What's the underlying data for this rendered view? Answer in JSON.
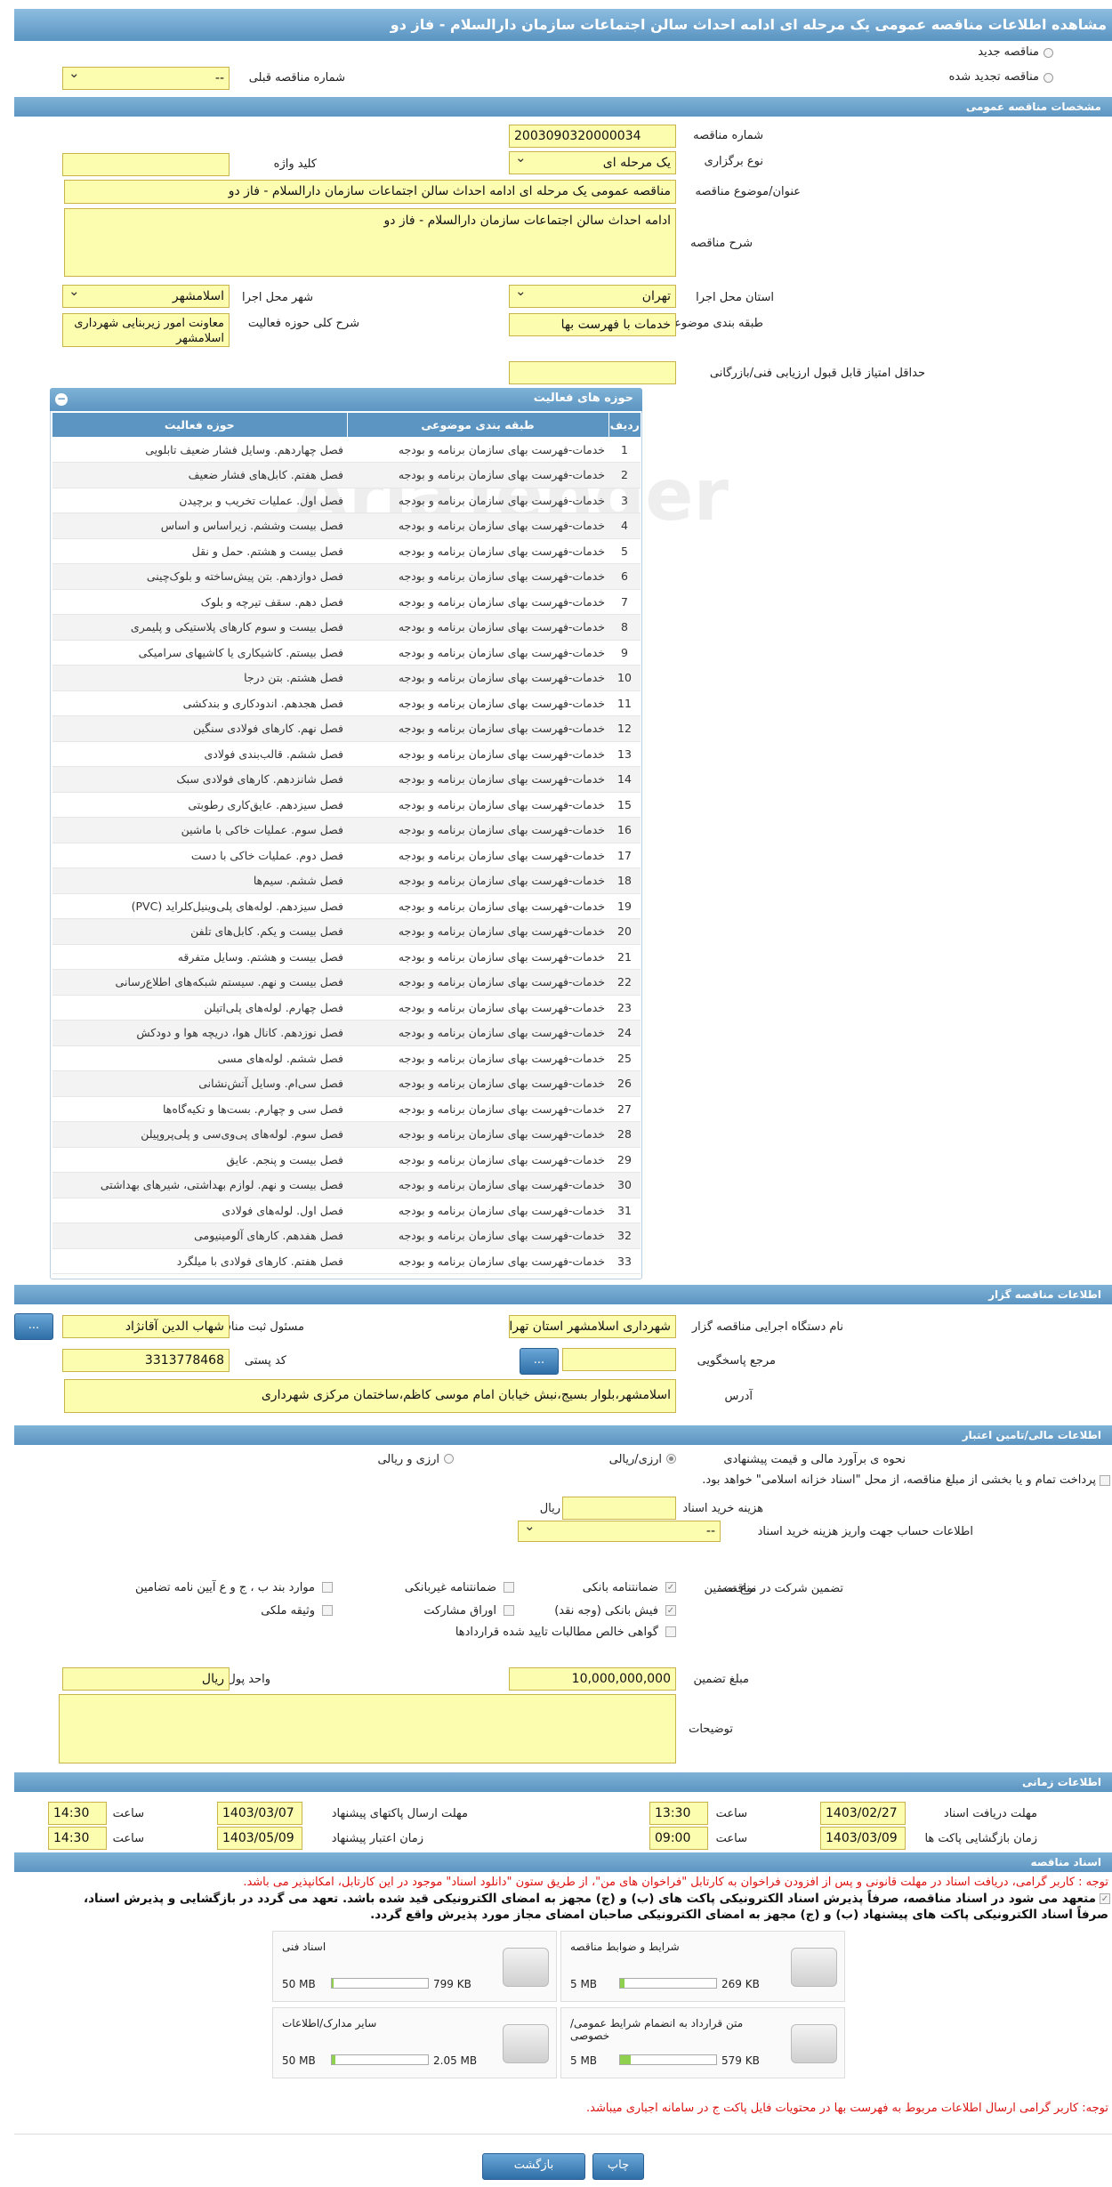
{
  "title": "مشاهده اطلاعات مناقصه عمومی یک مرحله ای ادامه احداث سالن اجتماعات سازمان دارالسلام - فاز دو",
  "top": {
    "new_tender": "مناقصه جدید",
    "renewed_tender": "مناقصه تجدید شده",
    "prev_number_label": "شماره مناقصه قبلی",
    "prev_number_value": "--"
  },
  "general": {
    "header": "مشخصات مناقصه عمومی",
    "number_label": "شماره مناقصه",
    "number_value": "2003090320000034",
    "type_label": "نوع برگزاری",
    "type_value": "یک مرحله ای",
    "keyword_label": "کلید واژه",
    "keyword_value": "",
    "subject_label": "عنوان/موضوع مناقصه",
    "subject_value": "مناقصه عمومی یک مرحله ای ادامه احداث سالن اجتماعات سازمان دارالسلام - فاز دو",
    "desc_label": "شرح مناقصه",
    "desc_value": "ادامه احداث سالن اجتماعات سازمان دارالسلام - فاز دو",
    "province_label": "استان محل اجرا",
    "province_value": "تهران",
    "city_label": "شهر محل اجرا",
    "city_value": "اسلامشهر",
    "category_label": "طبقه بندی موضوعی",
    "category_value": "خدمات با فهرست بها",
    "activity_desc_label": "شرح کلی حوزه فعالیت",
    "activity_desc_value": "معاونت امور زیربنایی شهرداری اسلامشهر",
    "min_score_label": "حداقل امتیاز قابل قبول ارزیابی فنی/بازرگانی",
    "min_score_value": ""
  },
  "activities": {
    "header": "حوزه های فعالیت",
    "col_row": "ردیف",
    "col_category": "طبقه بندی موضوعی",
    "col_field": "حوزه فعالیت",
    "rows": [
      {
        "n": "1",
        "c": "خدمات-فهرست بهای سازمان برنامه و بودجه",
        "f": "فصل چهاردهم. وسایل فشار ضعیف تابلویی"
      },
      {
        "n": "2",
        "c": "خدمات-فهرست بهای سازمان برنامه و بودجه",
        "f": "فصل هفتم. کابل‌های فشار ضعیف"
      },
      {
        "n": "3",
        "c": "خدمات-فهرست بهای سازمان برنامه و بودجه",
        "f": "فصل اول. عملیات تخریب و برچیدن"
      },
      {
        "n": "4",
        "c": "خدمات-فهرست بهای سازمان برنامه و بودجه",
        "f": "فصل بیست وششم. زیراساس و اساس"
      },
      {
        "n": "5",
        "c": "خدمات-فهرست بهای سازمان برنامه و بودجه",
        "f": "فصل بیست و هشتم. حمل و نقل"
      },
      {
        "n": "6",
        "c": "خدمات-فهرست بهای سازمان برنامه و بودجه",
        "f": "فصل دوازدهم. بتن پیش‌ساخته و بلوک‌چینی"
      },
      {
        "n": "7",
        "c": "خدمات-فهرست بهای سازمان برنامه و بودجه",
        "f": "فصل دهم. سقف تیرچه و بلوک"
      },
      {
        "n": "8",
        "c": "خدمات-فهرست بهای سازمان برنامه و بودجه",
        "f": "فصل بیست و سوم کارهای پلاستیکی و پلیمری"
      },
      {
        "n": "9",
        "c": "خدمات-فهرست بهای سازمان برنامه و بودجه",
        "f": "فصل بیستم. کاشیکاری یا کاشیهای سرامیکی"
      },
      {
        "n": "10",
        "c": "خدمات-فهرست بهای سازمان برنامه و بودجه",
        "f": "فصل هشتم. بتن درجا"
      },
      {
        "n": "11",
        "c": "خدمات-فهرست بهای سازمان برنامه و بودجه",
        "f": "فصل هجدهم. اندودکاری و بندکشی"
      },
      {
        "n": "12",
        "c": "خدمات-فهرست بهای سازمان برنامه و بودجه",
        "f": "فصل نهم. کارهای فولادی سنگین"
      },
      {
        "n": "13",
        "c": "خدمات-فهرست بهای سازمان برنامه و بودجه",
        "f": "فصل ششم. قالب‌بندی فولادی"
      },
      {
        "n": "14",
        "c": "خدمات-فهرست بهای سازمان برنامه و بودجه",
        "f": "فصل شانزدهم. کارهای فولادی سبک"
      },
      {
        "n": "15",
        "c": "خدمات-فهرست بهای سازمان برنامه و بودجه",
        "f": "فصل سیزدهم. عایق‌کاری رطوبتی"
      },
      {
        "n": "16",
        "c": "خدمات-فهرست بهای سازمان برنامه و بودجه",
        "f": "فصل سوم. عملیات خاکی با ماشین"
      },
      {
        "n": "17",
        "c": "خدمات-فهرست بهای سازمان برنامه و بودجه",
        "f": "فصل دوم. عملیات خاکی با دست"
      },
      {
        "n": "18",
        "c": "خدمات-فهرست بهای سازمان برنامه و بودجه",
        "f": "فصل ششم. سیم‌ها"
      },
      {
        "n": "19",
        "c": "خدمات-فهرست بهای سازمان برنامه و بودجه",
        "f": "فصل سیزدهم. لوله‌های پلی‌وینیل‌کلراید (PVC)"
      },
      {
        "n": "20",
        "c": "خدمات-فهرست بهای سازمان برنامه و بودجه",
        "f": "فصل بیست و یکم. کابل‌های تلفن"
      },
      {
        "n": "21",
        "c": "خدمات-فهرست بهای سازمان برنامه و بودجه",
        "f": "فصل بیست و هشتم. وسایل متفرقه"
      },
      {
        "n": "22",
        "c": "خدمات-فهرست بهای سازمان برنامه و بودجه",
        "f": "فصل بیست و نهم. سیستم شبکه‌های اطلاع‌رسانی"
      },
      {
        "n": "23",
        "c": "خدمات-فهرست بهای سازمان برنامه و بودجه",
        "f": "فصل چهارم. لوله‌های پلی‌اتیلن"
      },
      {
        "n": "24",
        "c": "خدمات-فهرست بهای سازمان برنامه و بودجه",
        "f": "فصل نوزدهم. کانال هوا، دریچه هوا و دودکش"
      },
      {
        "n": "25",
        "c": "خدمات-فهرست بهای سازمان برنامه و بودجه",
        "f": "فصل ششم. لوله‌های مسی"
      },
      {
        "n": "26",
        "c": "خدمات-فهرست بهای سازمان برنامه و بودجه",
        "f": "فصل سی‌ام. وسایل آتش‌نشانی"
      },
      {
        "n": "27",
        "c": "خدمات-فهرست بهای سازمان برنامه و بودجه",
        "f": "فصل سی و چهارم. بست‌ها و تکیه‌گاه‌ها"
      },
      {
        "n": "28",
        "c": "خدمات-فهرست بهای سازمان برنامه و بودجه",
        "f": "فصل سوم. لوله‌های پی‌وی‌سی و پلی‌پروپیلن"
      },
      {
        "n": "29",
        "c": "خدمات-فهرست بهای سازمان برنامه و بودجه",
        "f": "فصل بیست و پنجم. عایق"
      },
      {
        "n": "30",
        "c": "خدمات-فهرست بهای سازمان برنامه و بودجه",
        "f": "فصل بیست و نهم. لوازم بهداشتی، شیرهای بهداشتی"
      },
      {
        "n": "31",
        "c": "خدمات-فهرست بهای سازمان برنامه و بودجه",
        "f": "فصل اول. لوله‌های فولادی"
      },
      {
        "n": "32",
        "c": "خدمات-فهرست بهای سازمان برنامه و بودجه",
        "f": "فصل هفدهم. کارهای آلومینیومی"
      },
      {
        "n": "33",
        "c": "خدمات-فهرست بهای سازمان برنامه و بودجه",
        "f": "فصل هفتم. کارهای فولادی با میلگرد"
      }
    ]
  },
  "organizer": {
    "header": "اطلاعات مناقصه گزار",
    "device_label": "نام دستگاه اجرایی مناقصه گزار",
    "device_value": "شهرداری اسلامشهر استان تهران",
    "responsible_label": "مسئول ثبت مناقصه",
    "responsible_value": "شهاب الدین آقانژاد",
    "ref_label": "مرجع پاسخگویی",
    "ref_value": "",
    "postal_label": "کد پستی",
    "postal_value": "3313778468",
    "address_label": "آدرس",
    "address_value": "اسلامشهر،بلوار بسیج،نبش خیابان امام موسی کاظم،ساختمان مرکزی شهرداری",
    "more_btn": "..."
  },
  "financial": {
    "header": "اطلاعات مالی/تامین اعتبار",
    "estimate_label": "نحوه ی برآورد مالی و قیمت پیشنهادی",
    "opt_rial_fx": "ارزی/ریالی",
    "opt_fx_and_rial": "ارزی و ریالی",
    "payment_note": "پرداخت تمام و یا بخشی از مبلغ مناقصه، از محل \"اسناد خزانه اسلامی\" خواهد بود.",
    "doc_fee_label": "هزینه خرید اسناد",
    "doc_fee_unit": "ریال",
    "account_label": "اطلاعات حساب جهت واریز هزینه خرید اسناد",
    "account_value": "--"
  },
  "guarantee": {
    "title": "تضمین شرکت در مناقصه:",
    "type_label": "نوع تضمین",
    "opt_bank_guarantee": "ضمانتنامه بانکی",
    "opt_nonbank_guarantee": "ضمانتنامه غیربانکی",
    "opt_clauses": "موارد بند ب ، ج و ع آیین نامه تضامین",
    "opt_bank_receipt": "فیش بانکی (وجه نقد)",
    "opt_bonds": "اوراق مشارکت",
    "opt_property": "وثیقه ملکی",
    "opt_net_claims": "گواهی خالص مطالبات تایید شده قراردادها",
    "amount_label": "مبلغ تضمین",
    "amount_value": "10,000,000,000",
    "currency_label": "واحد پول",
    "currency_value": "ریال",
    "notes_label": "توضیحات",
    "notes_value": ""
  },
  "timing": {
    "header": "اطلاعات زمانی",
    "doc_receive_label": "مهلت دریافت اسناد",
    "doc_receive_date": "1403/02/27",
    "doc_receive_time": "13:30",
    "submit_label": "مهلت ارسال پاکتهای پیشنهاد",
    "submit_date": "1403/03/07",
    "submit_time": "14:30",
    "open_label": "زمان بازگشایی پاکت ها",
    "open_date": "1403/03/09",
    "open_time": "09:00",
    "valid_label": "زمان اعتبار پیشنهاد",
    "valid_date": "1403/05/09",
    "valid_time": "14:30",
    "time_word": "ساعت"
  },
  "documents": {
    "header": "اسناد مناقصه",
    "note1": "توجه : کاربر گرامی، دریافت اسناد در مهلت قانونی و پس از افزودن فراخوان به کارتابل \"فراخوان های من\"، از طریق ستون \"دانلود اسناد\" موجود در این کارتابل، امکانپذیر می باشد.",
    "note2_line1": "متعهد می شود در اسناد مناقصه، صرفاً پذیرش اسناد الکترونیکی پاکت های (ب) و (ج) مجهز به امضای الکترونیکی قید شده باشد. تعهد می گردد در بازگشایی و پذیرش اسناد،",
    "note2_line2": "صرفاً اسناد الکترونیکی پاکت های پیشنهاد (ب) و (ج) مجهز به امضای الکترونیکی صاحبان امضای مجاز مورد پذیرش واقع گردد.",
    "files": [
      {
        "name": "شرایط و ضوابط مناقصه",
        "max": "5 MB",
        "size": "269 KB",
        "fill": 0.05
      },
      {
        "name": "اسناد فنی",
        "max": "50 MB",
        "size": "799 KB",
        "fill": 0.02
      },
      {
        "name": "متن قرارداد به انضمام شرایط عمومی/خصوصی",
        "max": "5 MB",
        "size": "579 KB",
        "fill": 0.11
      },
      {
        "name": "سایر مدارک/اطلاعات",
        "max": "50 MB",
        "size": "2.05 MB",
        "fill": 0.04
      }
    ],
    "note3": "توجه: کاربر گرامی ارسال اطلاعات مربوط به فهرست بها در محتویات فایل پاکت ج در سامانه اجباری میباشد."
  },
  "footer": {
    "print_btn": "چاپ",
    "back_btn": "بازگشت"
  }
}
